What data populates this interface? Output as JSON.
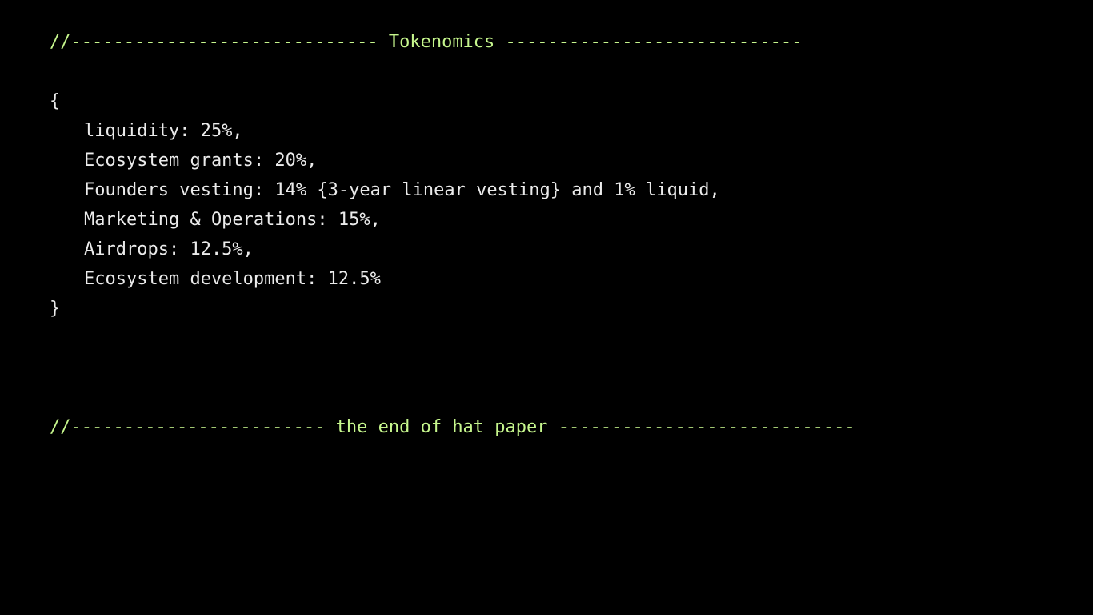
{
  "header": {
    "comment": "//----------------------------- Tokenomics ----------------------------"
  },
  "block": {
    "open": "{",
    "close": "}",
    "items": [
      "liquidity: 25%,",
      "Ecosystem grants: 20%,",
      "Founders vesting: 14% {3-year linear vesting} and 1% liquid,",
      "Marketing & Operations: 15%,",
      "Airdrops: 12.5%,",
      "Ecosystem development: 12.5%"
    ]
  },
  "footer": {
    "comment": "//------------------------ the end of hat paper ----------------------------"
  },
  "colors": {
    "background": "#000000",
    "comment": "#c6f68d",
    "text": "#ebebeb"
  }
}
